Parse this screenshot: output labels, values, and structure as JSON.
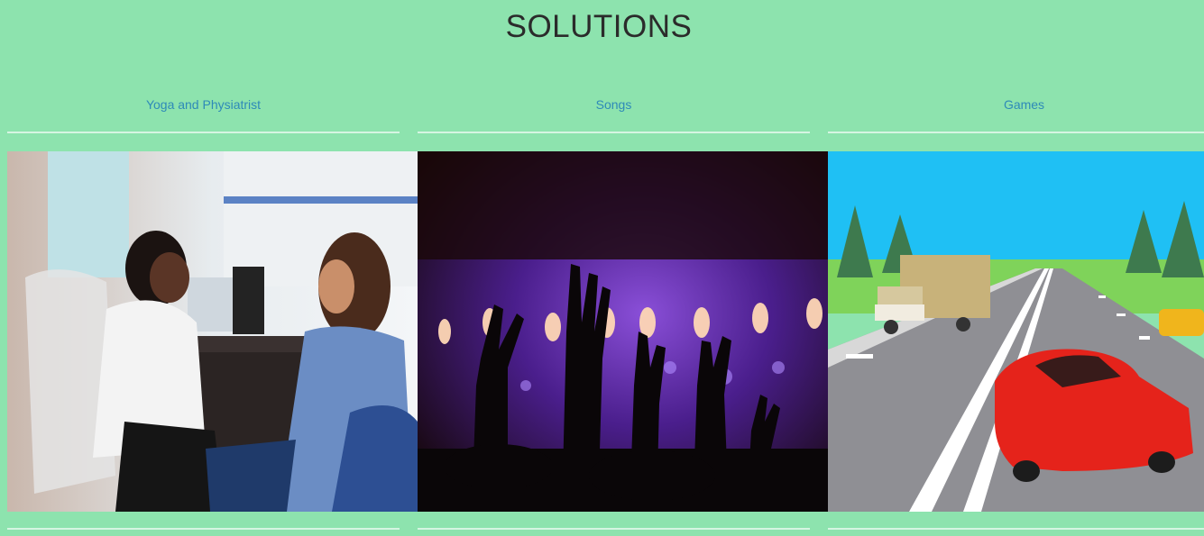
{
  "page": {
    "title": "SOLUTIONS"
  },
  "columns": [
    {
      "label": "Yoga and Physiatrist",
      "image": "counseling-session-photo"
    },
    {
      "label": "Songs",
      "image": "concert-crowd-photo"
    },
    {
      "label": "Games",
      "image": "racing-game-screenshot"
    }
  ],
  "colors": {
    "background": "#8de3ae",
    "link": "#2e8ab8",
    "title": "#2b2b2b"
  }
}
